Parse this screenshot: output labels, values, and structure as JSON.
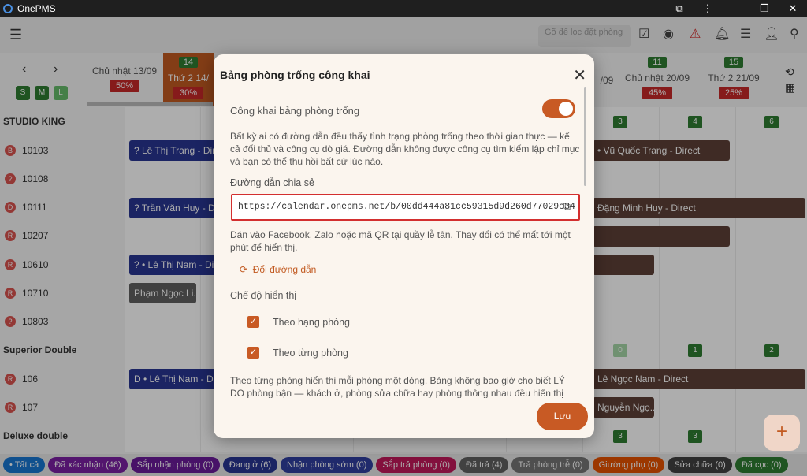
{
  "app": {
    "title": "OnePMS"
  },
  "toolbar": {
    "filter_placeholder": "Gõ để lọc đặt phòng"
  },
  "dates": [
    {
      "label": "Chủ nhật 13/09",
      "num": "",
      "occ": "50%"
    },
    {
      "label": "Thứ 2 14/",
      "num": "14",
      "occ": "30%"
    },
    {
      "label": "Chủ nhật 20/09",
      "num": "11",
      "occ": "45%"
    },
    {
      "label": "Thứ 2 21/09",
      "num": "15",
      "occ": "25%"
    },
    {
      "label": "/09",
      "num": "",
      "occ": ""
    }
  ],
  "size_buttons": [
    "S",
    "M",
    "L"
  ],
  "rooms": [
    {
      "label": "STUDIO KING",
      "status": ""
    },
    {
      "label": "10103",
      "status": "B"
    },
    {
      "label": "10108",
      "status": "?"
    },
    {
      "label": "10111",
      "status": "D"
    },
    {
      "label": "10207",
      "status": "R"
    },
    {
      "label": "10610",
      "status": "R"
    },
    {
      "label": "10710",
      "status": "R"
    },
    {
      "label": "10803",
      "status": "?"
    },
    {
      "label": "Superior Double",
      "status": ""
    },
    {
      "label": "106",
      "status": "R"
    },
    {
      "label": "107",
      "status": "R"
    },
    {
      "label": "Deluxe double",
      "status": ""
    }
  ],
  "counts": {
    "row1": [
      "3",
      "4",
      "6"
    ],
    "row2": [
      "0",
      "1",
      "2"
    ],
    "row3": [
      "3",
      "3"
    ]
  },
  "bookings": [
    {
      "text": "? Lê Thị Trang - Direct"
    },
    {
      "text": "? Trần Văn Huy - Direc"
    },
    {
      "text": "? • Lê Thị Nam - Direc"
    },
    {
      "text": "Phạm Ngọc Li..."
    },
    {
      "text": "D • Lê Thị Nam - Direc"
    },
    {
      "text": "• Vũ Quốc Trang - Direct"
    },
    {
      "text": "Đặng Minh Huy - Direct"
    },
    {
      "text": "Lê Ngọc Nam - Direct"
    },
    {
      "text": "Nguyễn Ngọ..."
    }
  ],
  "modal": {
    "title": "Bảng phòng trống công khai",
    "toggle_label": "Công khai bảng phòng trống",
    "desc": "Bất kỳ ai có đường dẫn đều thấy tình trạng phòng trống theo thời gian thực — kể cả đối thủ và công cụ dò giá. Đường dẫn không được công cụ tìm kiếm lập chỉ mục và bạn có thể thu hồi bất cứ lúc nào.",
    "share_label": "Đường dẫn chia sẻ",
    "url": "https://calendar.onepms.net/b/00dd444a81cc59315d9d260d77029c34",
    "hint": "Dán vào Facebook, Zalo hoặc mã QR tại quầy lễ tân. Thay đổi có thể mất tới một phút để hiển thị.",
    "change_link": "Đổi đường dẫn",
    "mode_label": "Chế độ hiển thị",
    "opt1": "Theo hạng phòng",
    "opt2": "Theo từng phòng",
    "footer_text": "Theo từng phòng hiển thị mỗi phòng một dòng. Bảng không bao giờ cho biết LÝ DO phòng bận — khách ở, phòng sửa chữa hay phòng thông nhau đều hiển thị như nhau.",
    "save": "Lưu"
  },
  "chips": [
    {
      "label": "• Tất cả",
      "color": "#1976d2"
    },
    {
      "label": "Đã xác nhận (46)",
      "color": "#7b1fa2"
    },
    {
      "label": "Sắp nhận phòng (0)",
      "color": "#6a1b9a"
    },
    {
      "label": "Đang ở (6)",
      "color": "#283593"
    },
    {
      "label": "Nhận phòng sớm (0)",
      "color": "#303f9f"
    },
    {
      "label": "Sắp trả phòng (0)",
      "color": "#c2185b"
    },
    {
      "label": "Đã trả (4)",
      "color": "#616161"
    },
    {
      "label": "Trả phòng trễ (0)",
      "color": "#757575"
    },
    {
      "label": "Giường phụ (0)",
      "color": "#e65100"
    },
    {
      "label": "Sửa chữa (0)",
      "color": "#424242"
    },
    {
      "label": "Đã cọc (0)",
      "color": "#2e7d32"
    }
  ]
}
